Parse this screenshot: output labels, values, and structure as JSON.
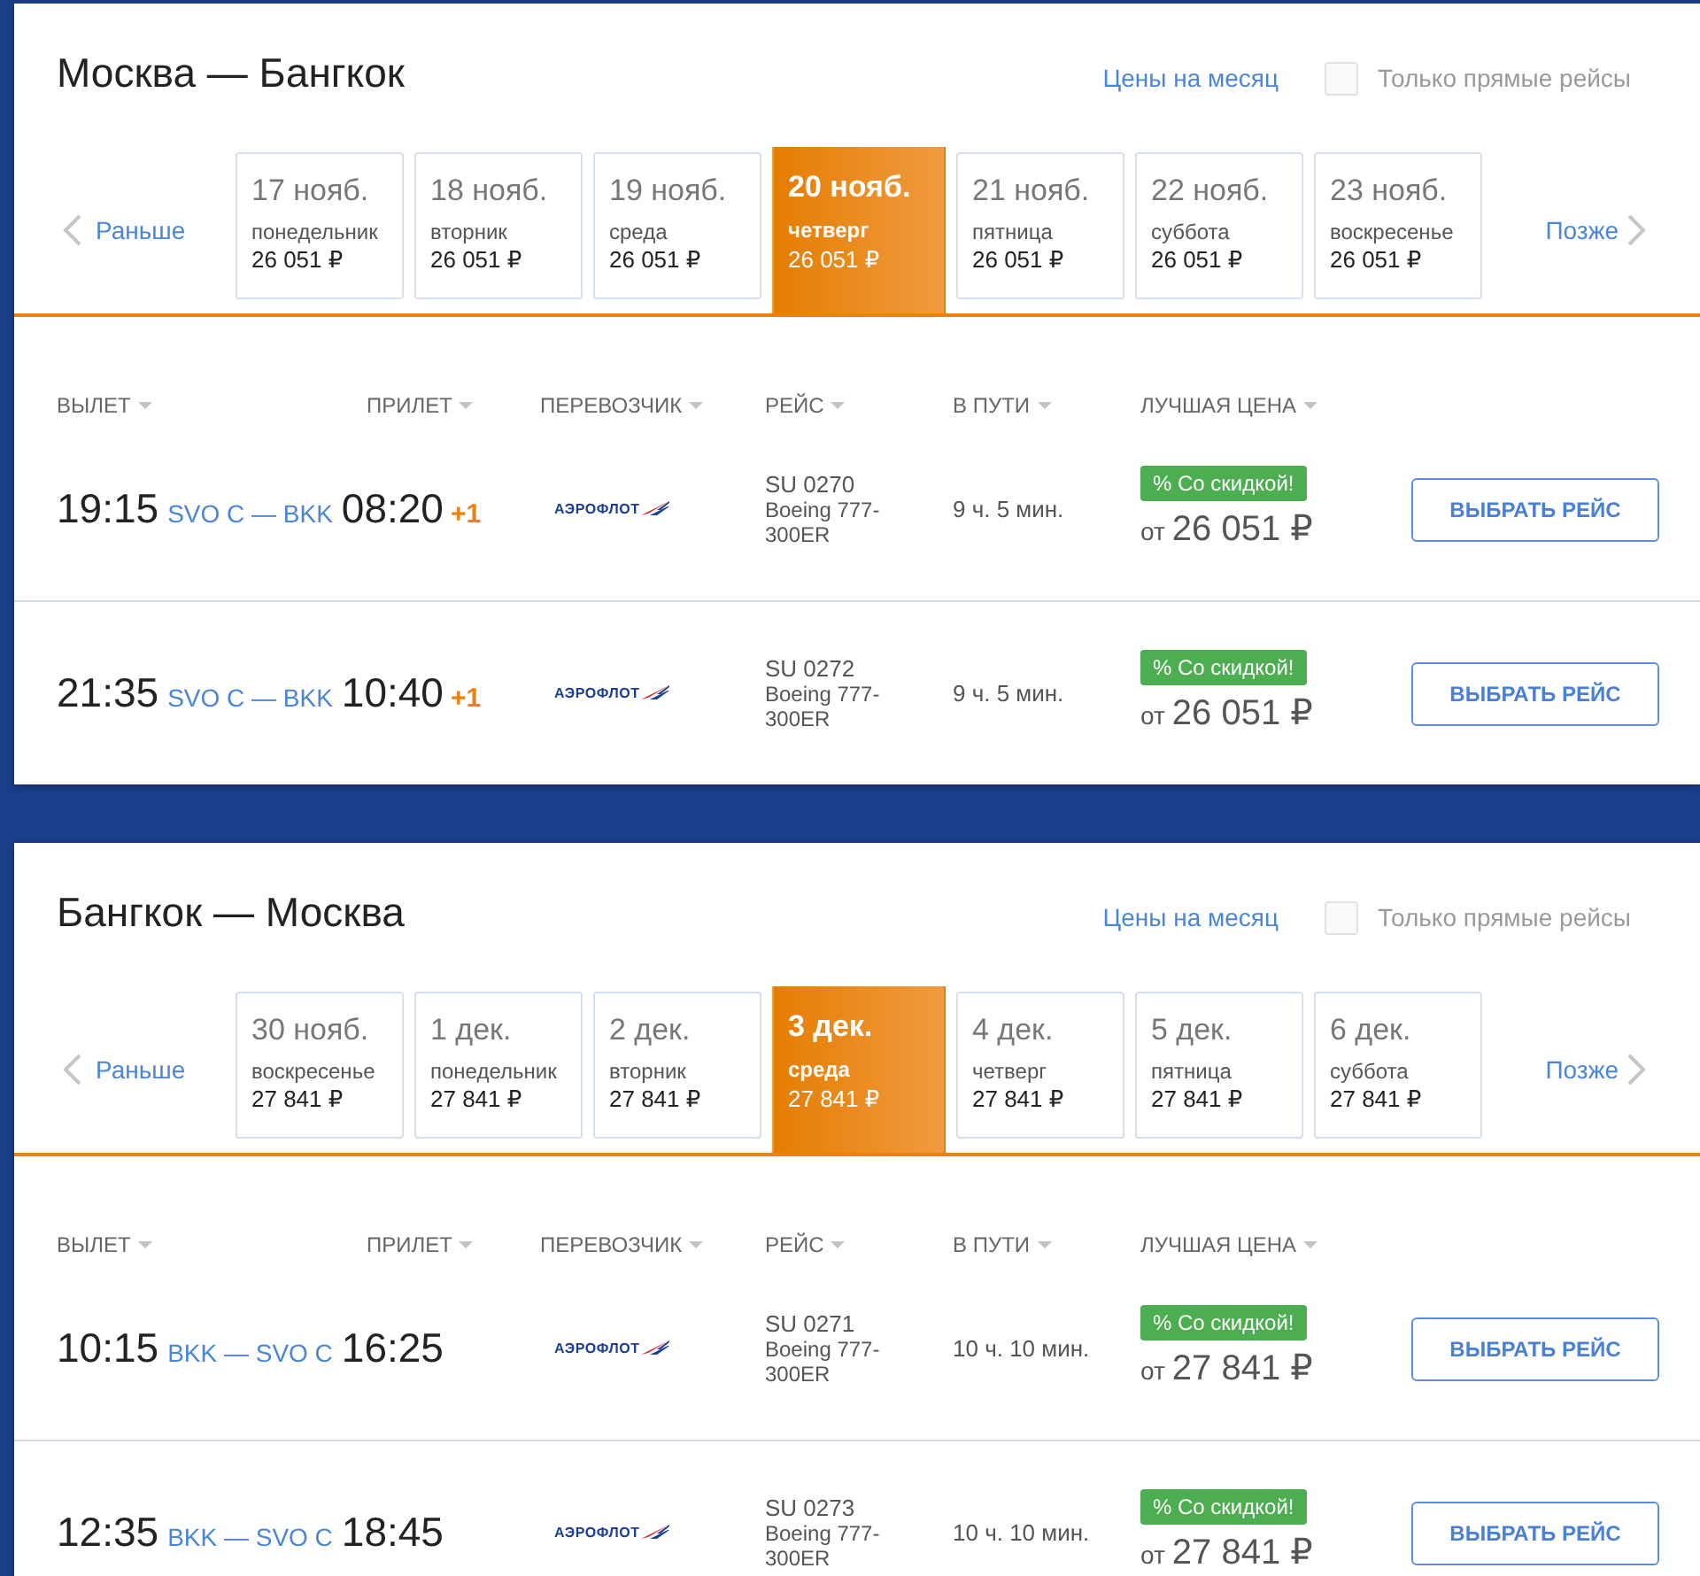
{
  "legs": [
    {
      "title": "Москва — Бангкок",
      "month_prices": "Цены на месяц",
      "direct_only": {
        "label": "Только прямые рейсы",
        "checked": false
      },
      "earlier": "Раньше",
      "later": "Позже",
      "dates": [
        {
          "date": "17 нояб.",
          "weekday": "понедельник",
          "price": "26 051 ₽",
          "selected": false
        },
        {
          "date": "18 нояб.",
          "weekday": "вторник",
          "price": "26 051 ₽",
          "selected": false
        },
        {
          "date": "19 нояб.",
          "weekday": "среда",
          "price": "26 051 ₽",
          "selected": false
        },
        {
          "date": "20 нояб.",
          "weekday": "четверг",
          "price": "26 051 ₽",
          "selected": true
        },
        {
          "date": "21 нояб.",
          "weekday": "пятница",
          "price": "26 051 ₽",
          "selected": false
        },
        {
          "date": "22 нояб.",
          "weekday": "суббота",
          "price": "26 051 ₽",
          "selected": false
        },
        {
          "date": "23 нояб.",
          "weekday": "воскресенье",
          "price": "26 051 ₽",
          "selected": false
        }
      ],
      "columns": [
        "ВЫЛЕТ",
        "ПРИЛЕТ",
        "ПЕРЕВОЗЧИК",
        "РЕЙС",
        "В ПУТИ",
        "ЛУЧШАЯ ЦЕНА"
      ],
      "flights": [
        {
          "departure": "19:15",
          "route": "SVO C — BKK",
          "arrival": "08:20",
          "next_day": "+1",
          "carrier": "АЭРОФЛОТ",
          "flight": "SU 0270",
          "aircraft": "Boeing 777-300ER",
          "duration": "9 ч. 5 мин.",
          "badge": "% Со скидкой!",
          "price_prefix": "от",
          "price": "26 051 ₽",
          "button": "ВЫБРАТЬ РЕЙС"
        },
        {
          "departure": "21:35",
          "route": "SVO C — BKK",
          "arrival": "10:40",
          "next_day": "+1",
          "carrier": "АЭРОФЛОТ",
          "flight": "SU 0272",
          "aircraft": "Boeing 777-300ER",
          "duration": "9 ч. 5 мин.",
          "badge": "% Со скидкой!",
          "price_prefix": "от",
          "price": "26 051 ₽",
          "button": "ВЫБРАТЬ РЕЙС"
        }
      ]
    },
    {
      "title": "Бангкок — Москва",
      "month_prices": "Цены на месяц",
      "direct_only": {
        "label": "Только прямые рейсы",
        "checked": false
      },
      "earlier": "Раньше",
      "later": "Позже",
      "dates": [
        {
          "date": "30 нояб.",
          "weekday": "воскресенье",
          "price": "27 841 ₽",
          "selected": false
        },
        {
          "date": "1 дек.",
          "weekday": "понедельник",
          "price": "27 841 ₽",
          "selected": false
        },
        {
          "date": "2 дек.",
          "weekday": "вторник",
          "price": "27 841 ₽",
          "selected": false
        },
        {
          "date": "3 дек.",
          "weekday": "среда",
          "price": "27 841 ₽",
          "selected": true
        },
        {
          "date": "4 дек.",
          "weekday": "четверг",
          "price": "27 841 ₽",
          "selected": false
        },
        {
          "date": "5 дек.",
          "weekday": "пятница",
          "price": "27 841 ₽",
          "selected": false
        },
        {
          "date": "6 дек.",
          "weekday": "суббота",
          "price": "27 841 ₽",
          "selected": false
        }
      ],
      "columns": [
        "ВЫЛЕТ",
        "ПРИЛЕТ",
        "ПЕРЕВОЗЧИК",
        "РЕЙС",
        "В ПУТИ",
        "ЛУЧШАЯ ЦЕНА"
      ],
      "flights": [
        {
          "departure": "10:15",
          "route": "BKK — SVO C",
          "arrival": "16:25",
          "carrier": "АЭРОФЛОТ",
          "flight": "SU 0271",
          "aircraft": "Boeing 777-300ER",
          "duration": "10 ч. 10 мин.",
          "badge": "% Со скидкой!",
          "price_prefix": "от",
          "price": "27 841 ₽",
          "button": "ВЫБРАТЬ РЕЙС"
        },
        {
          "departure": "12:35",
          "route": "BKK — SVO C",
          "arrival": "18:45",
          "carrier": "АЭРОФЛОТ",
          "flight": "SU 0273",
          "aircraft": "Boeing 777-300ER",
          "duration": "10 ч. 10 мин.",
          "badge": "% Со скидкой!",
          "price_prefix": "от",
          "price": "27 841 ₽",
          "button": "ВЫБРАТЬ РЕЙС"
        }
      ]
    }
  ]
}
